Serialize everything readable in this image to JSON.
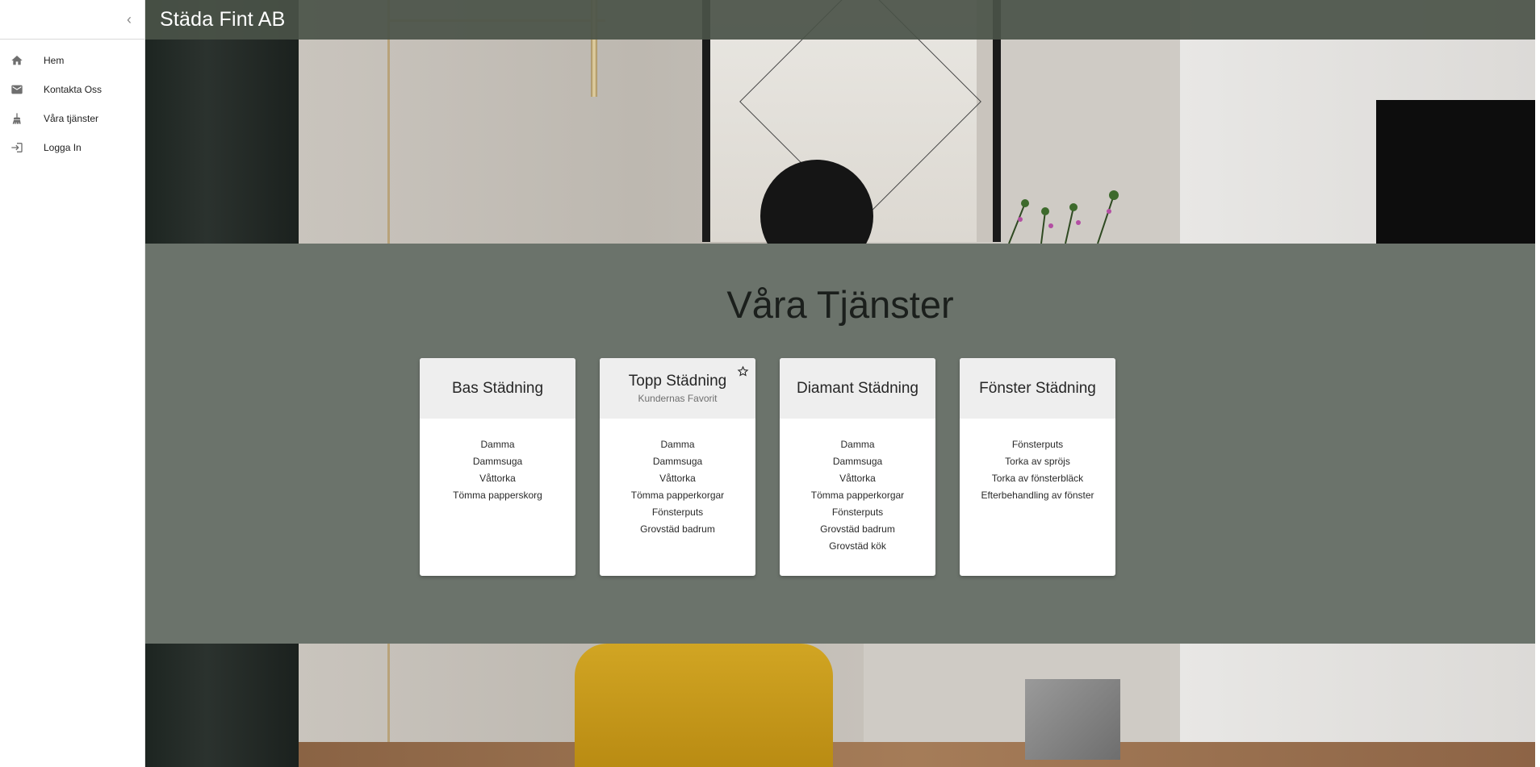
{
  "sidebar": {
    "collapse_icon": "‹",
    "items": [
      {
        "label": "Hem",
        "icon": "home-icon"
      },
      {
        "label": "Kontakta Oss",
        "icon": "mail-icon"
      },
      {
        "label": "Våra tjänster",
        "icon": "brush-icon"
      },
      {
        "label": "Logga In",
        "icon": "login-icon"
      }
    ]
  },
  "header": {
    "title": "Städa Fint AB"
  },
  "services": {
    "title": "Våra Tjänster",
    "cards": [
      {
        "title": "Bas Städning",
        "subtitle": "",
        "starred": false,
        "items": [
          "Damma",
          "Dammsuga",
          "Våttorka",
          "Tömma papperskorg"
        ]
      },
      {
        "title": "Topp Städning",
        "subtitle": "Kundernas Favorit",
        "starred": true,
        "items": [
          "Damma",
          "Dammsuga",
          "Våttorka",
          "Tömma papperkorgar",
          "Fönsterputs",
          "Grovstäd badrum"
        ]
      },
      {
        "title": "Diamant Städning",
        "subtitle": "",
        "starred": false,
        "items": [
          "Damma",
          "Dammsuga",
          "Våttorka",
          "Tömma papperkorgar",
          "Fönsterputs",
          "Grovstäd badrum",
          "Grovstäd kök"
        ]
      },
      {
        "title": "Fönster Städning",
        "subtitle": "",
        "starred": false,
        "items": [
          "Fönsterputs",
          "Torka av spröjs",
          "Torka av fönsterbläck",
          "Efterbehandling av fönster"
        ]
      }
    ]
  },
  "colors": {
    "appbar": "#4a5248",
    "section": "#6b736b",
    "card_head": "#eeeeee"
  }
}
